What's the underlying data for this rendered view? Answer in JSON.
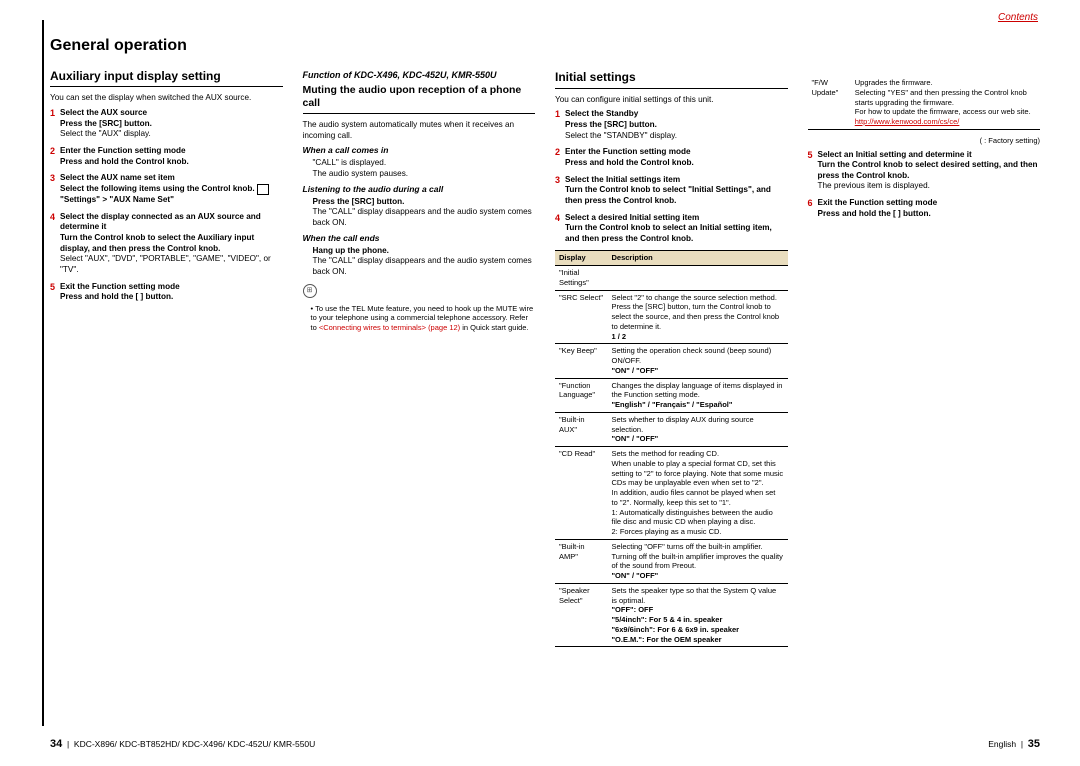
{
  "header": {
    "contents": "Contents",
    "title": "General operation"
  },
  "col1": {
    "h2": "Auxiliary input display setting",
    "intro": "You can set the display when switched the AUX source.",
    "s1b": "Select the AUX source",
    "s1b2": "Press the [SRC] button.",
    "s1t": "Select the \"AUX\" display.",
    "s2b": "Enter the Function setting mode",
    "s2b2": "Press and hold the Control knob.",
    "s3b": "Select the AUX name set item",
    "s3b2": "Select the following items using the Control knob.",
    "s3t": "\"Settings\" > \"AUX Name Set\"",
    "s4b": "Select the display connected as an AUX source and determine it",
    "s4b2": "Turn the Control knob to select the Auxiliary input display, and then press the Control knob.",
    "s4t": "Select \"AUX\", \"DVD\", \"PORTABLE\", \"GAME\", \"VIDEO\", or \"TV\".",
    "s5b": "Exit the Function setting mode",
    "s5b2": "Press and hold the [      ] button."
  },
  "col2": {
    "func": "Function of KDC-X496, KDC-452U, KMR-550U",
    "h3": "Muting the audio upon reception of a phone call",
    "intro": "The audio system automatically mutes when  it receives an incoming call.",
    "sub1": "When a call comes in",
    "sub1t1": "\"CALL\" is displayed.",
    "sub1t2": "The audio system pauses.",
    "sub2": "Listening to the audio during a call",
    "sub2b": "Press the [SRC] button.",
    "sub2t": "The \"CALL\" display disappears and the audio system comes back ON.",
    "sub3": "When the call ends",
    "sub3b": "Hang up the phone.",
    "sub3t": "The \"CALL\" display disappears and the audio system comes back ON.",
    "note": "To use the TEL Mute feature, you need to hook up the MUTE wire to your telephone using a commercial telephone accessory. Refer to ",
    "notelink": "<Connecting wires to terminals> (page 12)",
    "note2": " in Quick start guide."
  },
  "col3": {
    "h2": "Initial settings",
    "intro": "You can configure initial settings of this unit.",
    "s1b": "Select the Standby",
    "s1b2": "Press the [SRC] button.",
    "s1t": "Select the \"STANDBY\" display.",
    "s2b": "Enter the Function setting mode",
    "s2b2": "Press and hold the Control knob.",
    "s3b": "Select the Initial settings item",
    "s3b2": "Turn the Control knob to select \"Initial Settings\", and then press the Control knob.",
    "s4b": "Select a desired Initial setting item",
    "s4b2": "Turn the Control knob to select an Initial setting item, and then press the Control knob.",
    "th1": "Display",
    "th2": "Description",
    "r0": "\"Initial Settings\"",
    "r1a": "\"SRC Select\"",
    "r1b": "Select \"2\" to change the source selection method. Press the [SRC] button, turn the Control knob to select the source, and then press the Control knob to determine it.",
    "r1c": "1 / 2",
    "r2a": "\"Key Beep\"",
    "r2b": "Setting the operation check sound (beep sound) ON/OFF.",
    "r2c": "\"ON\" / \"OFF\"",
    "r3a": "\"Function Language\"",
    "r3b": "Changes the display language of items displayed in the Function setting mode.",
    "r3c": "\"English\" / \"Français\" / \"Español\"",
    "r4a": "\"Built-in AUX\"",
    "r4b": "Sets whether to display AUX during source selection.",
    "r4c": "\"ON\" / \"OFF\"",
    "r5a": "\"CD Read\"",
    "r5b": "Sets the method for reading CD.\nWhen unable to play a special format CD, set this setting to \"2\" to force playing. Note that some music CDs may be unplayable even when set to \"2\".\nIn addition, audio files cannot be played when set to \"2\". Normally, keep this set to \"1\".\n1: Automatically distinguishes between the audio file disc and music CD when playing a disc.\n2: Forces playing as a music CD.",
    "r6a": "\"Built-in AMP\"",
    "r6b": "Selecting \"OFF\" turns off the built-in amplifier. Turning off the built-in amplifier improves the quality of the sound from Preout.",
    "r6c": "\"ON\" / \"OFF\"",
    "r7a": "\"Speaker Select\"",
    "r7b": "Sets the speaker type so that the System Q value is optimal.",
    "r7c": "\"OFF\": OFF",
    "r7d": "\"5/4inch\": For 5 & 4 in. speaker",
    "r7e": "\"6x9/6inch\": For 6 & 6x9 in. speaker",
    "r7f": "\"O.E.M.\": For the OEM speaker"
  },
  "col4": {
    "r8a": "\"F/W Update\"",
    "r8b": "Upgrades the firmware.\nSelecting \"YES\" and then pressing the Control knob starts upgrading the firmware.\nFor how to update the firmware, access our web site.",
    "r8link": "http://www.kenwood.com/cs/ce/",
    "factory": "(        : Factory setting)",
    "s5b": "Select an Initial setting and determine it",
    "s5b2": "Turn the Control knob to select desired setting, and then press the Control knob.",
    "s5t": "The previous item is displayed.",
    "s6b": "Exit the Function setting mode",
    "s6b2": "Press and hold the [      ] button."
  },
  "footer": {
    "left": "KDC-X896/ KDC-BT852HD/ KDC-X496/ KDC-452U/ KMR-550U",
    "right": "English",
    "p1": "34",
    "p2": "35"
  }
}
